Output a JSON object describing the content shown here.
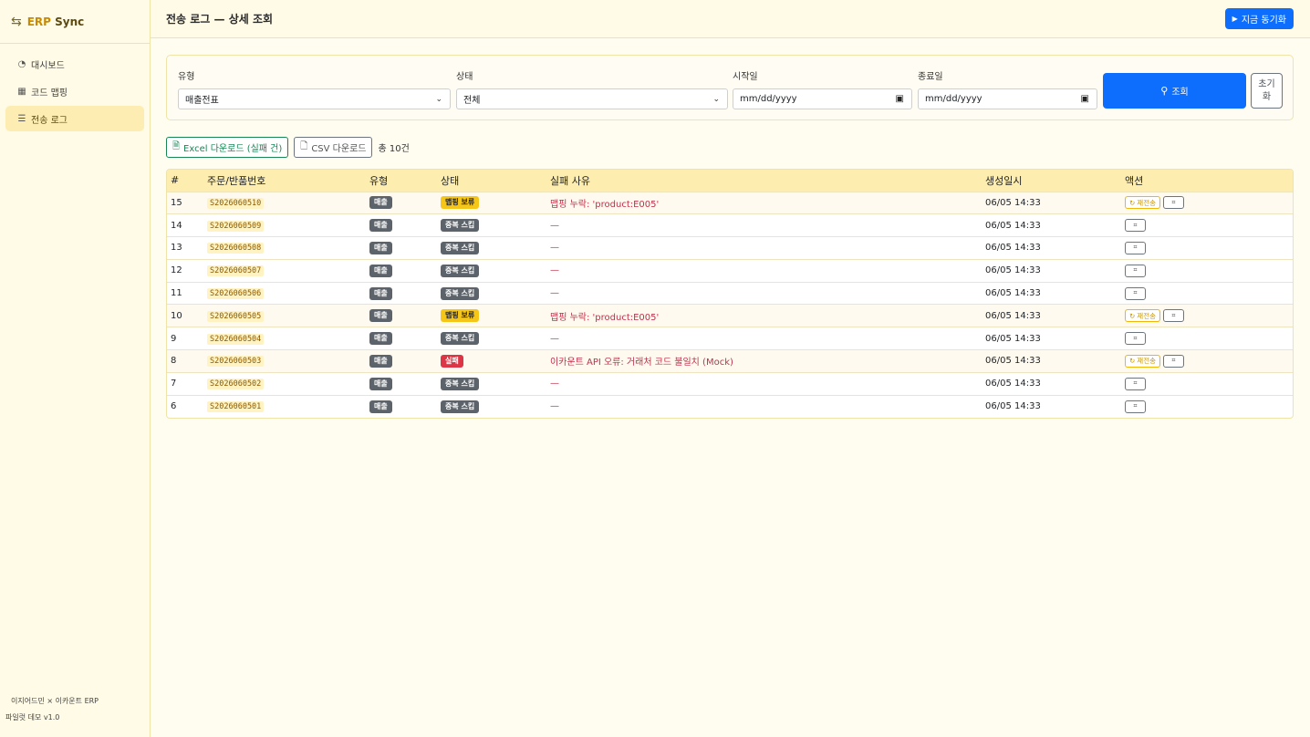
{
  "app": {
    "brand_prefix": "ERP",
    "brand_suffix": "Sync",
    "brand_icon": "arrows-swap-icon"
  },
  "sidebar": {
    "items": [
      {
        "label": "대시보드",
        "icon": "speedometer-icon",
        "active": false
      },
      {
        "label": "코드 맵핑",
        "icon": "table-icon",
        "active": false
      },
      {
        "label": "전송 로그",
        "icon": "list-icon",
        "active": true
      }
    ],
    "footer_line1": "이지어드민 × 이카운트 ERP",
    "footer_line2": "파일럿 데모 v1.0"
  },
  "header": {
    "title": "전송 로그 — 상세 조회",
    "sync_label": "지금 동기화"
  },
  "filters": {
    "type_label": "유형",
    "type_value": "매출전표",
    "status_label": "상태",
    "status_value": "전체",
    "start_label": "시작일",
    "start_placeholder": "mm/dd/yyyy",
    "end_label": "종료일",
    "end_placeholder": "mm/dd/yyyy",
    "search_label": "조회",
    "reset_label": "초기화"
  },
  "toolbar": {
    "excel_label": "Excel 다운로드 (실패 건)",
    "csv_label": "CSV 다운로드",
    "total_label": "총 10건"
  },
  "table": {
    "headers": [
      "#",
      "주문/반품번호",
      "유형",
      "상태",
      "실패 사유",
      "생성일시",
      "액션"
    ],
    "retry_label": "재전송",
    "rows": [
      {
        "id": "15",
        "order": "S2026060510",
        "type": "매출",
        "status": "맵핑 보류",
        "status_kind": "yellow",
        "reason": "맵핑 누락: 'product:E005'",
        "created": "06/05 14:33",
        "retry": true
      },
      {
        "id": "14",
        "order": "S2026060509",
        "type": "매출",
        "status": "중복 스킵",
        "status_kind": "gray",
        "reason": "—",
        "created": "06/05 14:33",
        "retry": false
      },
      {
        "id": "13",
        "order": "S2026060508",
        "type": "매출",
        "status": "중복 스킵",
        "status_kind": "gray",
        "reason": "—",
        "created": "06/05 14:33",
        "retry": false
      },
      {
        "id": "12",
        "order": "S2026060507",
        "type": "매출",
        "status": "중복 스킵",
        "status_kind": "gray",
        "reason": "—",
        "created": "06/05 14:33",
        "retry": false
      },
      {
        "id": "11",
        "order": "S2026060506",
        "type": "매출",
        "status": "중복 스킵",
        "status_kind": "gray",
        "reason": "—",
        "created": "06/05 14:33",
        "retry": false
      },
      {
        "id": "10",
        "order": "S2026060505",
        "type": "매출",
        "status": "맵핑 보류",
        "status_kind": "yellow",
        "reason": "맵핑 누락: 'product:E005'",
        "created": "06/05 14:33",
        "retry": true
      },
      {
        "id": "9",
        "order": "S2026060504",
        "type": "매출",
        "status": "중복 스킵",
        "status_kind": "gray",
        "reason": "—",
        "created": "06/05 14:33",
        "retry": false
      },
      {
        "id": "8",
        "order": "S2026060503",
        "type": "매출",
        "status": "실패",
        "status_kind": "red",
        "reason": "이카운트 API 오류: 거래처 코드 불일치 (Mock)",
        "created": "06/05 14:33",
        "retry": true
      },
      {
        "id": "7",
        "order": "S2026060502",
        "type": "매출",
        "status": "중복 스킵",
        "status_kind": "gray",
        "reason": "—",
        "created": "06/05 14:33",
        "retry": false
      },
      {
        "id": "6",
        "order": "S2026060501",
        "type": "매출",
        "status": "중복 스킵",
        "status_kind": "gray",
        "reason": "—",
        "created": "06/05 14:33",
        "retry": false
      }
    ]
  },
  "colors": {
    "primary": "#0d6efd",
    "accent": "#c98a00",
    "sidebar_bg": "#fffbe6",
    "danger": "#dc3545",
    "warning": "#f5c518",
    "success": "#198754"
  }
}
